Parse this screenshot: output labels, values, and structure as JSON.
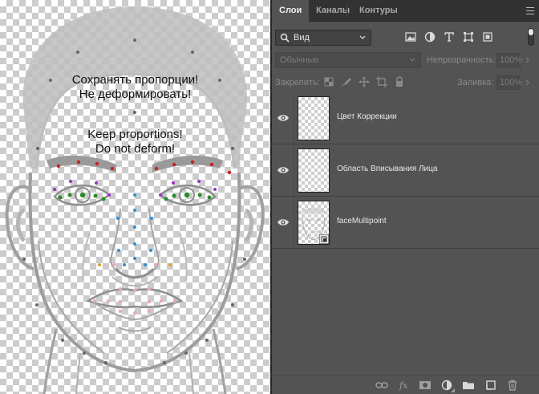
{
  "canvas": {
    "text_ru_line1": "Сохранять пропорции!",
    "text_ru_line2": "Не деформировать!",
    "text_en_line1": "Keep proportions!",
    "text_en_line2": "Do not deform!"
  },
  "panel": {
    "tabs": [
      {
        "label": "Слои",
        "active": true
      },
      {
        "label": "Каналы",
        "active": false
      },
      {
        "label": "Контуры",
        "active": false
      }
    ],
    "filter": {
      "selected": "Вид",
      "icons": [
        "image-filter-icon",
        "adjustment-filter-icon",
        "type-filter-icon",
        "shape-filter-icon",
        "smart-object-filter-icon"
      ]
    },
    "blend_mode": "Обычные",
    "opacity_label": "Непрозрачность:",
    "opacity_value": "100%",
    "lock_label": "Закрепить:",
    "fill_label": "Заливка:",
    "fill_value": "100%",
    "layers": [
      {
        "name": "Цвет Коррекции",
        "visible": true,
        "smart_object": false
      },
      {
        "name": "Область Вписывания Лица",
        "visible": true,
        "smart_object": false
      },
      {
        "name": "faceMultipoint",
        "visible": true,
        "smart_object": true
      }
    ],
    "bottom_icons": [
      "link-layers-icon",
      "fx-icon",
      "add-mask-icon",
      "adjustment-layer-icon",
      "new-group-icon",
      "new-layer-icon",
      "delete-layer-icon"
    ]
  },
  "colors": {
    "panel_bg": "#535353",
    "tab_bar": "#323232",
    "brow_dot": "#cc1f1f",
    "eye_dot": "#2a8a2a",
    "eye_outer_dot": "#9b30c8",
    "nose_dot": "#2e8fd6",
    "mouth_dot": "#e8a6c4",
    "nostril_dot": "#e3a12a",
    "contour_dot": "#666666"
  }
}
